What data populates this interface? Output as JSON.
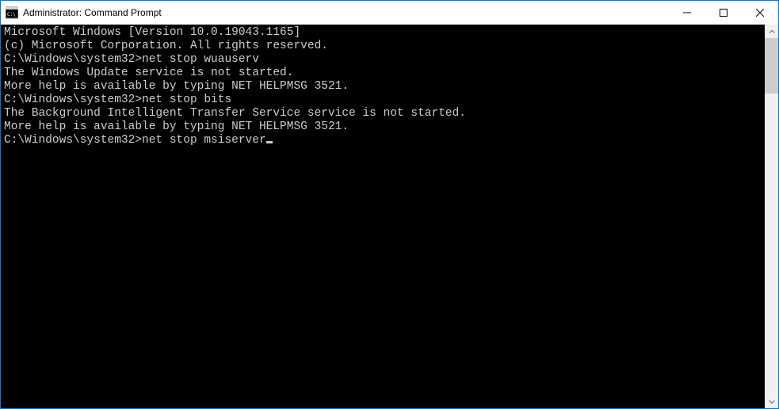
{
  "window": {
    "title": "Administrator: Command Prompt"
  },
  "terminal": {
    "lines": [
      "Microsoft Windows [Version 10.0.19043.1165]",
      "(c) Microsoft Corporation. All rights reserved.",
      "",
      "C:\\Windows\\system32>net stop wuauserv",
      "The Windows Update service is not started.",
      "",
      "More help is available by typing NET HELPMSG 3521.",
      "",
      "",
      "C:\\Windows\\system32>net stop bits",
      "The Background Intelligent Transfer Service service is not started.",
      "",
      "More help is available by typing NET HELPMSG 3521.",
      "",
      "",
      "C:\\Windows\\system32>net stop msiserver"
    ],
    "cursor_on_last_line": true
  }
}
